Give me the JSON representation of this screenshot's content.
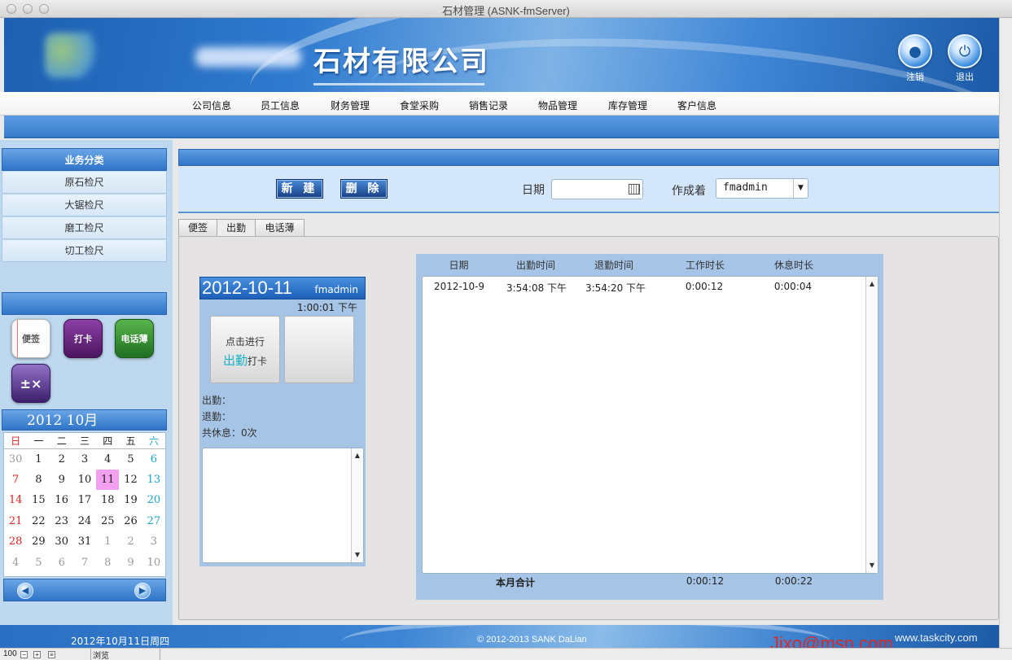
{
  "window": {
    "title": "石材管理 (ASNK-fmServer)"
  },
  "header": {
    "company": "石材有限公司",
    "logout_label": "注销",
    "exit_label": "退出"
  },
  "nav": [
    "公司信息",
    "员工信息",
    "财务管理",
    "食堂采购",
    "销售记录",
    "物品管理",
    "库存管理",
    "客户信息"
  ],
  "sidebar": {
    "title": "业务分类",
    "items": [
      "原石检尺",
      "大锯检尺",
      "磨工检尺",
      "切工检尺"
    ],
    "apps": {
      "note": "便签",
      "punch": "打卡",
      "phonebook": "电话薄"
    }
  },
  "calendar": {
    "header": "2012  10月",
    "weekdays": [
      "日",
      "一",
      "二",
      "三",
      "四",
      "五",
      "六"
    ],
    "weeks": [
      [
        "30",
        "1",
        "2",
        "3",
        "4",
        "5",
        "6"
      ],
      [
        "7",
        "8",
        "9",
        "10",
        "11",
        "12",
        "13"
      ],
      [
        "14",
        "15",
        "16",
        "17",
        "18",
        "19",
        "20"
      ],
      [
        "21",
        "22",
        "23",
        "24",
        "25",
        "26",
        "27"
      ],
      [
        "28",
        "29",
        "30",
        "31",
        "1",
        "2",
        "3"
      ],
      [
        "4",
        "5",
        "6",
        "7",
        "8",
        "9",
        "10"
      ]
    ],
    "today": "11"
  },
  "toolbar": {
    "new_label": "新 建",
    "delete_label": "删 除",
    "date_label": "日期",
    "date_value": "",
    "author_label": "作成着",
    "author_value": "fmadmin"
  },
  "tabs": [
    "便签",
    "出勤",
    "电话薄"
  ],
  "active_tab": "出勤",
  "attendance": {
    "date": "2012-10-11",
    "user": "fmadmin",
    "time": "1:00:01 下午",
    "punch_line1": "点击进行",
    "punch_highlight": "出勤",
    "punch_suffix": "打卡",
    "in_label": "出勤：",
    "out_label": "退勤：",
    "break_label": "共休息：0次"
  },
  "records": {
    "columns": [
      "日期",
      "出勤时间",
      "退勤时间",
      "工作时长",
      "休息时长"
    ],
    "rows": [
      [
        "2012-10-9",
        "3:54:08 下午",
        "3:54:20 下午",
        "0:00:12",
        "0:00:04"
      ]
    ],
    "total_label": "本月合计",
    "total_work": "0:00:12",
    "total_break": "0:00:22"
  },
  "footer": {
    "date": "2012年10月11日周四",
    "copyright": "© 2012-2013 SANK DaLian",
    "site": "www.taskcity.com",
    "watermark": "Jixo@msn.com"
  },
  "statusbar": {
    "zoom": "100",
    "mode": "浏览"
  }
}
